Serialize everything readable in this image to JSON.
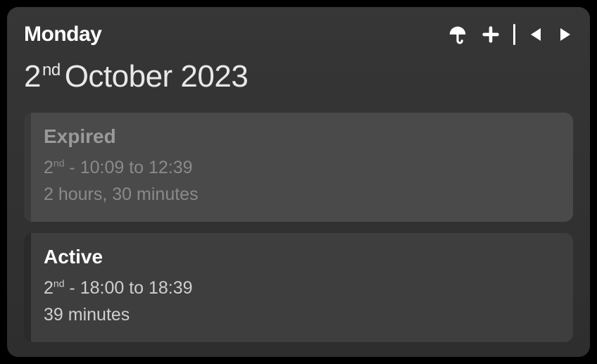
{
  "header": {
    "day_name": "Monday",
    "date_day": "2",
    "date_ordinal": "nd",
    "date_rest": "October 2023"
  },
  "cards": [
    {
      "status": "expired",
      "title": "Expired",
      "time_day": "2",
      "time_ordinal": "nd",
      "time_range": " - 10:09 to 12:39",
      "duration": "2 hours, 30 minutes"
    },
    {
      "status": "active",
      "title": "Active",
      "time_day": "2",
      "time_ordinal": "nd",
      "time_range": " - 18:00 to 18:39",
      "duration": "39 minutes"
    }
  ]
}
